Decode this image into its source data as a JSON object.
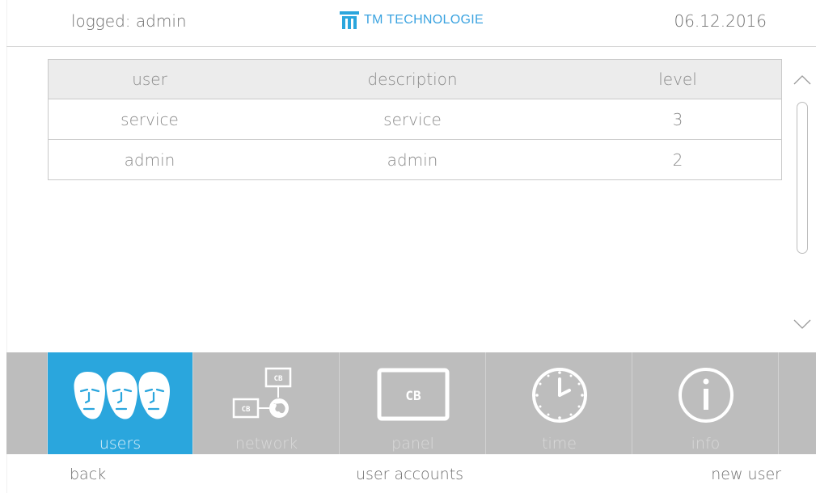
{
  "header": {
    "logged": "logged: admin",
    "brand_tm": "TM",
    "brand_rest": "TECHNOLOGIE",
    "date": "06.12.2016"
  },
  "table": {
    "columns": [
      "user",
      "description",
      "level"
    ],
    "rows": [
      {
        "user": "service",
        "description": "service",
        "level": "3"
      },
      {
        "user": "admin",
        "description": "admin",
        "level": "2"
      }
    ]
  },
  "nav": {
    "items": [
      {
        "label": "users",
        "icon": "users-icon",
        "active": true
      },
      {
        "label": "network",
        "icon": "network-icon",
        "active": false
      },
      {
        "label": "panel",
        "icon": "panel-icon",
        "active": false
      },
      {
        "label": "time",
        "icon": "clock-icon",
        "active": false
      },
      {
        "label": "info",
        "icon": "info-icon",
        "active": false
      }
    ],
    "network_box_label": "CB",
    "panel_box_label": "CB"
  },
  "footer": {
    "back": "back",
    "title": "user accounts",
    "new_user": "new user"
  },
  "colors": {
    "accent": "#2aa6dd",
    "nav_bg": "#bdbdbd",
    "logo": "#3aa3e0"
  }
}
